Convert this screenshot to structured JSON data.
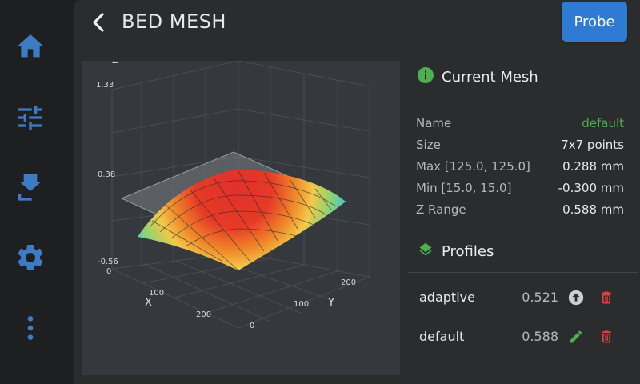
{
  "colors": {
    "accent": "#3d7bc4",
    "probe": "#2f7bd3",
    "info_green": "#4caf50",
    "delete_red": "#e0413f"
  },
  "sidebar": {
    "items": [
      {
        "icon": "home-icon"
      },
      {
        "icon": "tune-icon"
      },
      {
        "icon": "extrude-icon"
      },
      {
        "icon": "gear-icon"
      },
      {
        "icon": "more-vertical-icon"
      }
    ]
  },
  "header": {
    "title": "BED MESH",
    "probe_label": "Probe"
  },
  "graph": {
    "z_axis_label": "Z",
    "z_ticks": [
      "1.33",
      "0.38",
      "-0.56"
    ],
    "x_axis_label": "X",
    "x_ticks": [
      "0",
      "100",
      "200"
    ],
    "y_axis_label": "Y",
    "y_ticks": [
      "0",
      "100",
      "200"
    ]
  },
  "current_mesh": {
    "title": "Current Mesh",
    "rows": [
      {
        "key": "Name",
        "value": "default"
      },
      {
        "key": "Size",
        "value": "7x7 points"
      },
      {
        "key": "Max [125.0, 125.0]",
        "value": "0.288 mm"
      },
      {
        "key": "Min [15.0, 15.0]",
        "value": "-0.300 mm"
      },
      {
        "key": "Z Range",
        "value": "0.588 mm"
      }
    ]
  },
  "profiles": {
    "title": "Profiles",
    "items": [
      {
        "name": "adaptive",
        "range": "0.521",
        "action_icon": "load-up-arrow-icon"
      },
      {
        "name": "default",
        "range": "0.588",
        "action_icon": "pencil-icon"
      }
    ]
  }
}
